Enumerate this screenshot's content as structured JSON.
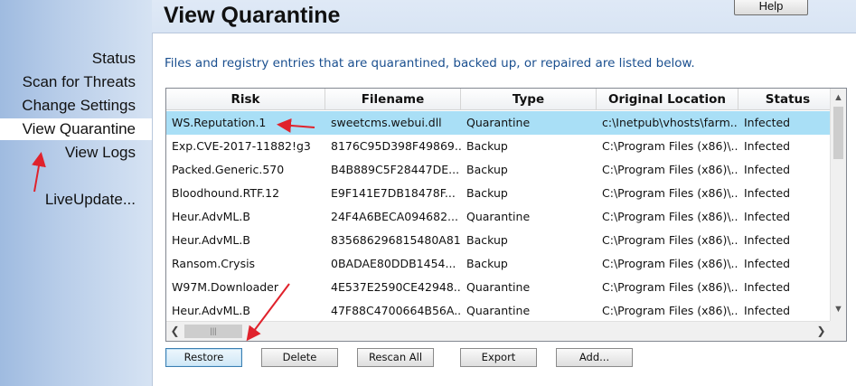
{
  "page": {
    "title": "View Quarantine",
    "help_label": "Help",
    "description": "Files and registry entries that are quarantined, backed up, or repaired are listed below."
  },
  "sidebar": {
    "items": [
      {
        "label": "Status"
      },
      {
        "label": "Scan for Threats"
      },
      {
        "label": "Change Settings"
      },
      {
        "label": "View Quarantine",
        "active": true
      },
      {
        "label": "View Logs"
      },
      {
        "label": "LiveUpdate..."
      }
    ]
  },
  "table": {
    "columns": [
      "Risk",
      "Filename",
      "Type",
      "Original Location",
      "Status"
    ],
    "rows": [
      {
        "risk": "WS.Reputation.1",
        "filename": "sweetcms.webui.dll",
        "type": "Quarantine",
        "location": "c:\\Inetpub\\vhosts\\farm...",
        "status": "Infected",
        "selected": true
      },
      {
        "risk": "Exp.CVE-2017-11882!g3",
        "filename": "8176C95D398F49869...",
        "type": "Backup",
        "location": "C:\\Program Files (x86)\\...",
        "status": "Infected"
      },
      {
        "risk": "Packed.Generic.570",
        "filename": "B4B889C5F28447DE...",
        "type": "Backup",
        "location": "C:\\Program Files (x86)\\...",
        "status": "Infected"
      },
      {
        "risk": "Bloodhound.RTF.12",
        "filename": "E9F141E7DB18478F...",
        "type": "Backup",
        "location": "C:\\Program Files (x86)\\...",
        "status": "Infected"
      },
      {
        "risk": "Heur.AdvML.B",
        "filename": "24F4A6BECA094682...",
        "type": "Quarantine",
        "location": "C:\\Program Files (x86)\\...",
        "status": "Infected"
      },
      {
        "risk": "Heur.AdvML.B",
        "filename": "835686296815480A81...",
        "type": "Backup",
        "location": "C:\\Program Files (x86)\\...",
        "status": "Infected"
      },
      {
        "risk": "Ransom.Crysis",
        "filename": "0BADAE80DDB1454...",
        "type": "Backup",
        "location": "C:\\Program Files (x86)\\...",
        "status": "Infected"
      },
      {
        "risk": "W97M.Downloader",
        "filename": "4E537E2590CE42948...",
        "type": "Quarantine",
        "location": "C:\\Program Files (x86)\\...",
        "status": "Infected"
      },
      {
        "risk": "Heur.AdvML.B",
        "filename": "47F88C4700664B56A...",
        "type": "Quarantine",
        "location": "C:\\Program Files (x86)\\...",
        "status": "Infected"
      }
    ]
  },
  "buttons": {
    "restore": "Restore",
    "delete": "Delete",
    "rescan_all": "Rescan All",
    "export": "Export",
    "add": "Add..."
  },
  "icons": {
    "scroll_left": "chevron-left-icon",
    "scroll_right": "chevron-right-icon",
    "scroll_up": "chevron-up-icon",
    "scroll_down": "chevron-down-icon"
  },
  "colors": {
    "selected_row": "#a9dff6",
    "annotation_arrow": "#e0222c",
    "description_text": "#1a4f8f"
  }
}
